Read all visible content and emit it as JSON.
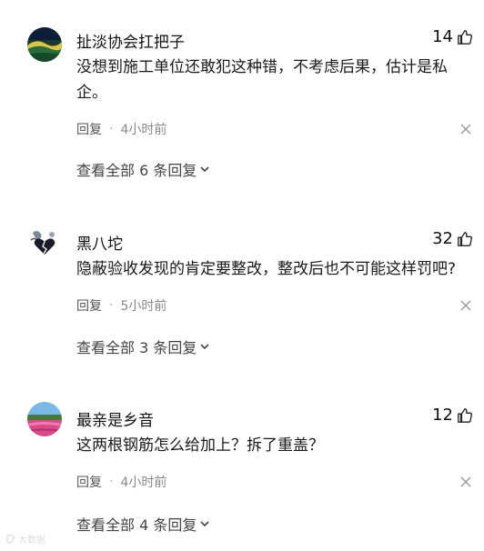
{
  "comments": [
    {
      "username": "扯淡协会扛把子",
      "likes": "14",
      "text": "没想到施工单位还敢犯这种错，不考虑后果，估计是私企。",
      "reply_label": "回复",
      "time": "4小时前",
      "view_all": "查看全部 6 条回复",
      "avatar_icon": "landscape-avatar-icon"
    },
    {
      "username": "黑八坨",
      "likes": "32",
      "text": "隐蔽验收发现的肯定要整改，整改后也不可能这样罚吧?",
      "reply_label": "回复",
      "time": "5小时前",
      "view_all": "查看全部 3 条回复",
      "avatar_icon": "broken-heart-avatar-icon"
    },
    {
      "username": "最亲是乡音",
      "likes": "12",
      "text": "这两根钢筋怎么给加上？拆了重盖？",
      "reply_label": "回复",
      "time": "4小时前",
      "view_all": "查看全部 4 条回复",
      "avatar_icon": "flower-field-avatar-icon"
    }
  ],
  "watermark": "大数据"
}
